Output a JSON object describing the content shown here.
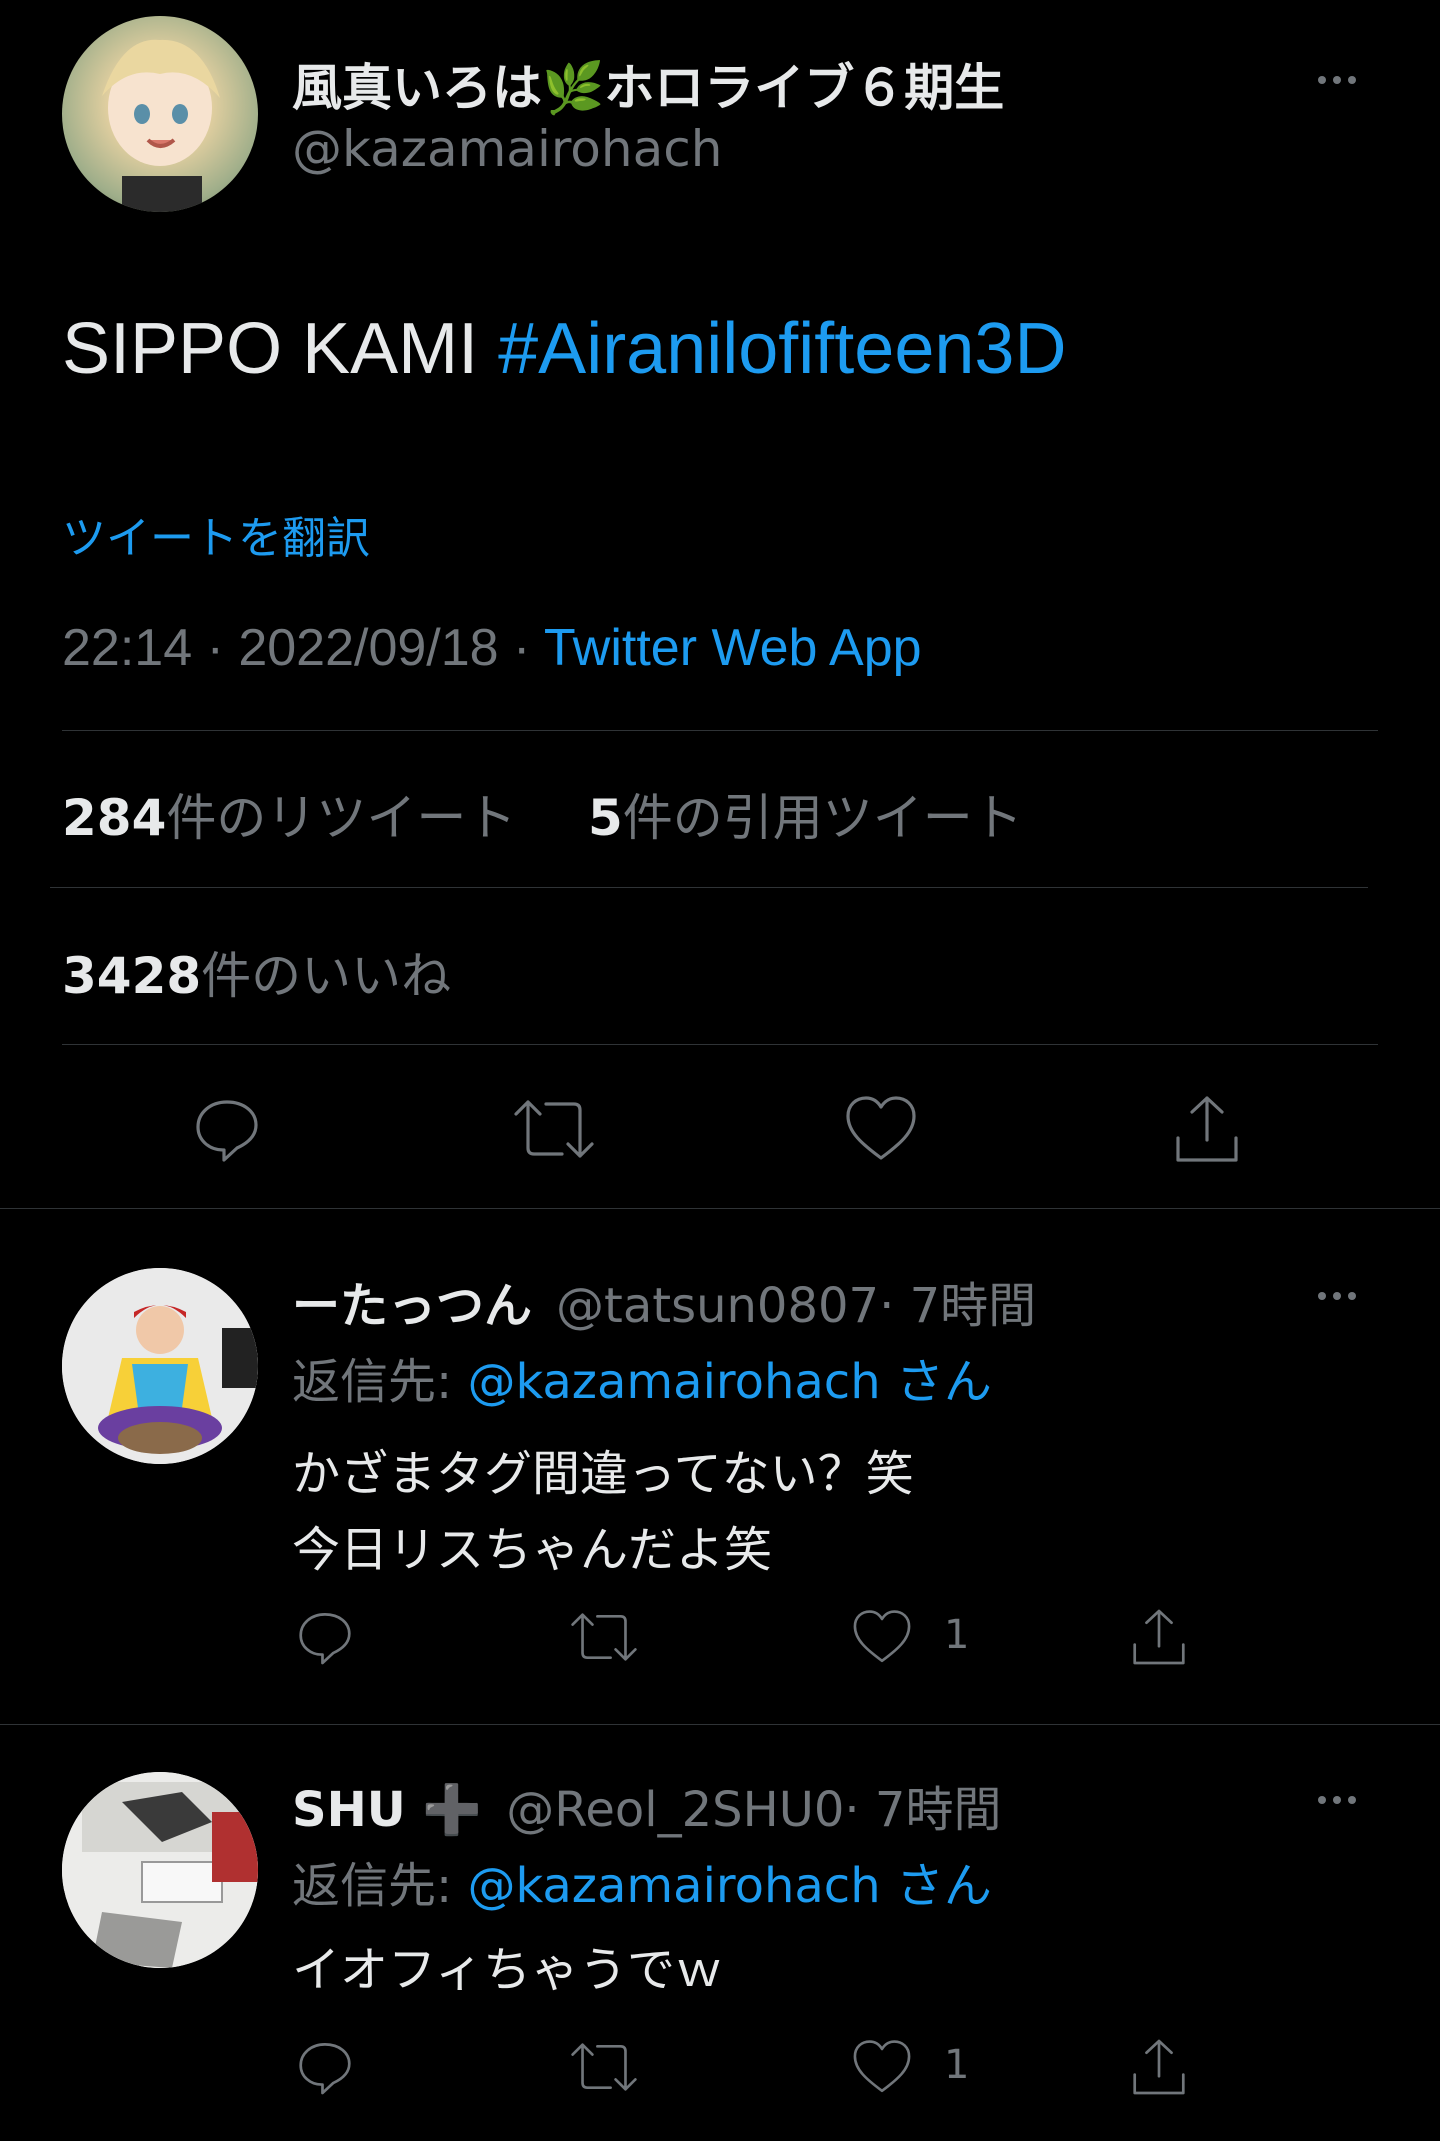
{
  "tweet": {
    "display_name": "風真いろは🌿ホロライブ６期生",
    "handle": "@kazamairohach",
    "text": "SIPPO KAMI",
    "hashtag": "#Airanilofifteen3D",
    "translate_label": "ツイートを翻訳",
    "time": "22:14 · 2022/09/18 · ",
    "source": "Twitter Web App",
    "retweets_count": "284",
    "retweets_label": "件のリツイート",
    "quotes_count": "5",
    "quotes_label": "件の引用ツイート",
    "likes_count": "3428",
    "likes_label": "件のいいね"
  },
  "actions": {
    "reply": "reply-icon",
    "retweet": "retweet-icon",
    "like": "heart-icon",
    "share": "share-icon"
  },
  "replies": [
    {
      "display_name": "ーたっつん",
      "handle": "@tatsun0807",
      "time": " · 7時間",
      "reply_to_label": "返信先: ",
      "reply_to_handle": "@kazamairohach",
      "reply_to_suffix": " さん",
      "text_line1": "かざまタグ間違ってない？笑",
      "text_line2": "今日リスちゃんだよ笑",
      "like_count": "1"
    },
    {
      "display_name": "SHU ➕",
      "handle": "@Reol_2SHU0",
      "time": " · 7時間",
      "reply_to_label": "返信先: ",
      "reply_to_handle": "@kazamairohach",
      "reply_to_suffix": " さん",
      "text_line1": "イオフィちゃうでｗ",
      "like_count": "1"
    }
  ],
  "colors": {
    "background": "#000000",
    "text": "#e7e9ea",
    "muted": "#71767b",
    "link": "#1d9bf0",
    "divider": "#2f3336"
  }
}
